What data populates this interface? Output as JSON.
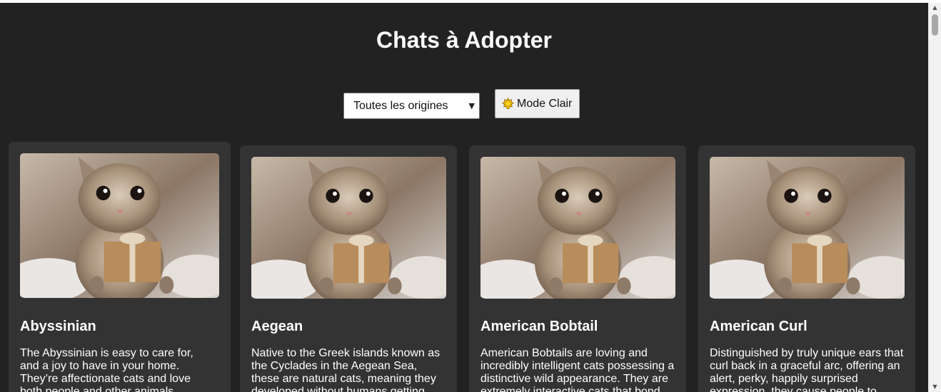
{
  "page": {
    "title": "Chats à Adopter"
  },
  "controls": {
    "origin_filter_value": "Toutes les origines",
    "theme_button_label": "Mode Clair",
    "theme_icon": "sun-icon"
  },
  "cats": [
    {
      "name": "Abyssinian",
      "image": "kitten-with-gift-photo",
      "description": "The Abyssinian is easy to care for, and a joy to have in your home. They’re affectionate cats and love both people and other animals."
    },
    {
      "name": "Aegean",
      "image": "kitten-with-gift-photo",
      "description": "Native to the Greek islands known as the Cyclades in the Aegean Sea, these are natural cats, meaning they developed without humans getting"
    },
    {
      "name": "American Bobtail",
      "image": "kitten-with-gift-photo",
      "description": "American Bobtails are loving and incredibly intelligent cats possessing a distinctive wild appearance. They are extremely interactive cats that bond"
    },
    {
      "name": "American Curl",
      "image": "kitten-with-gift-photo",
      "description": "Distinguished by truly unique ears that curl back in a graceful arc, offering an alert, perky, happily surprised expression, they cause people to"
    }
  ],
  "colors": {
    "page_background": "#222222",
    "card_background": "#333333",
    "text": "#ffffff"
  }
}
